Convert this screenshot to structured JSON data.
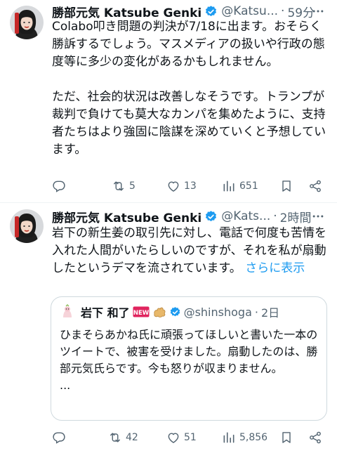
{
  "tweets": [
    {
      "author_name": "勝部元気 Katsube Genki",
      "handle": "@Katsu...",
      "separator": "·",
      "time": "59分",
      "paragraphs": [
        "Colabo叩き問題の判決が7/18に出ます。おそらく勝訴するでしょう。マスメディアの扱いや行政の態度等に多少の変化があるかもしれません。",
        "ただ、社会的状況は改善しなそうです。トランプが裁判で負けても莫大なカンパを集めたように、支持者たちはより強固に陰謀を深めていくと予想しています。"
      ],
      "reply_count": "",
      "retweet_count": "5",
      "like_count": "13",
      "view_count": "651"
    },
    {
      "author_name": "勝部元気 Katsube Genki",
      "handle": "@Kats...",
      "separator": "·",
      "time": "2時間",
      "text": "岩下の新生姜の取引先に対し、電話で何度も苦情を入れた人間がいたらしいのですが、それを私が扇動したというデマを流されています。",
      "show_more": "さらに表示",
      "quote": {
        "author_name": "岩下 和了",
        "new_badge": "NEW",
        "handle": "@shinshoga",
        "separator": "·",
        "time": "2日",
        "text": "ひまそらあかね氏に頑張ってほしいと書いた一本のツイートで、被害を受けました。扇動したのは、勝部元気氏らです。今も怒りが収まりません。",
        "ellipsis": "..."
      },
      "reply_count": "",
      "retweet_count": "42",
      "like_count": "51",
      "view_count": "5,856"
    }
  ],
  "colors": {
    "accent": "#1d9bf0",
    "text": "#0f1419",
    "secondary": "#536471",
    "border": "#cfd9de",
    "new_badge": "#e0245e"
  },
  "icons": [
    "verified-icon",
    "more-icon",
    "reply-icon",
    "retweet-icon",
    "like-icon",
    "views-icon",
    "bookmark-icon",
    "share-icon"
  ]
}
